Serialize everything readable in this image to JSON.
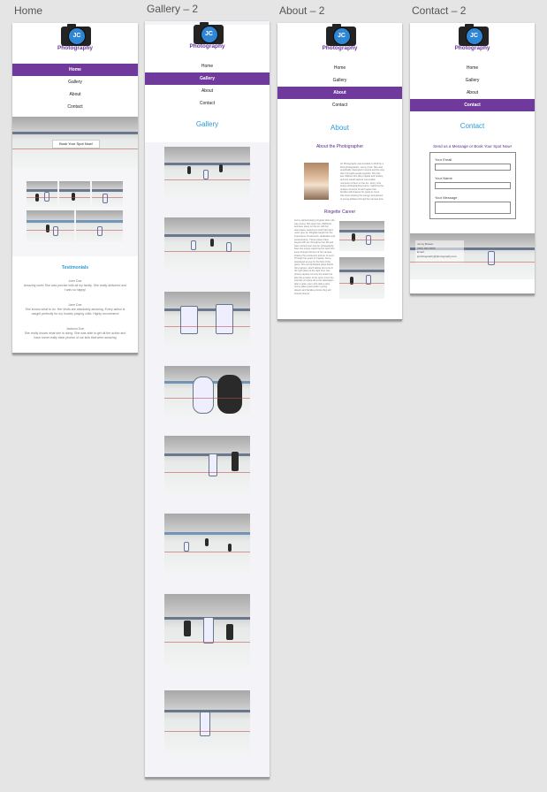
{
  "frames": {
    "home": "Home",
    "gallery": "Gallery – 2",
    "about": "About – 2",
    "contact": "Contact – 2"
  },
  "logo": {
    "initials": "JC",
    "text": "Photography"
  },
  "nav": [
    "Home",
    "Gallery",
    "About",
    "Contact"
  ],
  "home": {
    "cta": "Book Your Spot Now!",
    "testimonials_title": "Testimonials",
    "testimonials": [
      {
        "name": "John Doe",
        "quote": "Amazing work! She was precise with all my family. She really delivered and I was so happy!"
      },
      {
        "name": "Jane Doe",
        "quote": "She knows what to do. Her shots are absolutely amazing. Every action is caught perfectly for my hockey playing child. Highly recommend"
      },
      {
        "name": "Jackson Doe",
        "quote": "She really knows what she is doing. She was able to get all the action and have some really clear photos of our kids that were amazing"
      }
    ]
  },
  "gallery": {
    "title": "Gallery"
  },
  "about": {
    "title": "About",
    "subtitle": "About the Photographer",
    "bio": "JC Photography was founded in 2019 by a local photographer, Jenny Cook. She was specifically interested in sports and the way that it brought people together. She has two children who play ringette and hockey, and she would capture memorable moments of them on the ice. Jenny now enjoys photographing teams, capturing the unique moments of each game that families will treasure for years to come. She loves sharing the energy and passion of young athletes through her camera lens.",
    "career_title": "Ringette Career",
    "career": "Jenny started playing ringette when she was young. She spent her childhood and teen years on the ice with her teammates, learning to work hard and never give up. Ringette taught her the importance of teamwork, dedication and perseverance. These values have stayed with her throughout her life and have carried over into her photography. Now she enjoys capturing the sport she loves through the lens of her camera, sharing the excitement and joy of every game with players and families alike.",
    "career2": "Through her years in ringette, Jenny developed an eye for the flow of the game. She can anticipate plays before they happen, which allows her to be in the right place at the right time. Her photos capture not only the action but also the emotion of the sport. From the intensity of a face-off to the celebration after a goal, every shot tells a story. Jenny takes great pride in giving players and families photos they will cherish forever."
  },
  "contact": {
    "title": "Contact",
    "form_title": "Send us a Message or Book Your Spot Now!",
    "fields": [
      "Your Email",
      "Your Name",
      "Your Message"
    ],
    "footer_name": "Jenny Brower",
    "footer_phone": "(555) 555-5555",
    "footer_email_label": "Email:",
    "footer_email": "jcphotography@photography.com"
  }
}
